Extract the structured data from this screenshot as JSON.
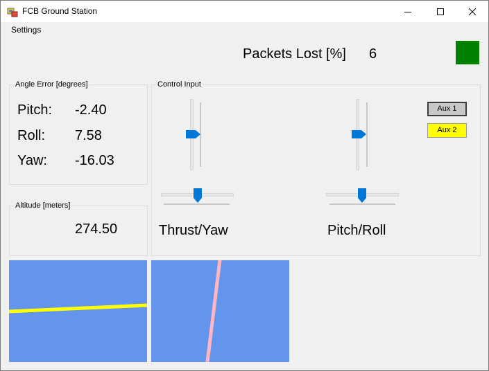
{
  "window": {
    "title": "FCB Ground Station"
  },
  "menu": {
    "items": [
      "Settings"
    ]
  },
  "packets": {
    "label": "Packets Lost [%]",
    "value": "6",
    "status_color": "#008000"
  },
  "angle_error": {
    "caption": "Angle Error [degrees]",
    "rows": [
      {
        "label": "Pitch:",
        "value": "-2.40"
      },
      {
        "label": "Roll:",
        "value": "7.58"
      },
      {
        "label": "Yaw:",
        "value": "-16.03"
      }
    ]
  },
  "altitude": {
    "caption": "Altitude [meters]",
    "value": "274.50"
  },
  "control_input": {
    "caption": "Control Input",
    "sticks": [
      {
        "label": "Thrust/Yaw",
        "vertical_level": 0.5,
        "horizontal_level": 0.5
      },
      {
        "label": "Pitch/Roll",
        "vertical_level": 0.5,
        "horizontal_level": 0.5
      }
    ],
    "aux1_label": "Aux 1",
    "aux2_label": "Aux 2"
  },
  "indicators": {
    "background_color": "#6495ed",
    "roll_line_color": "#ffff00",
    "yaw_line_color": "#ffb6c1"
  }
}
